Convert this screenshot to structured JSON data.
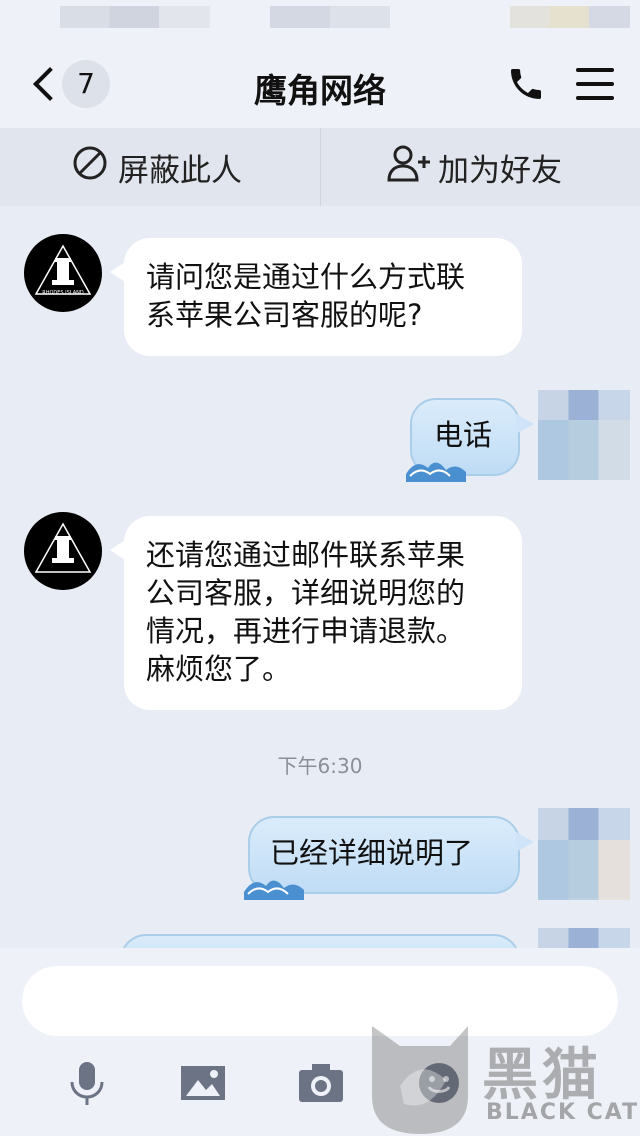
{
  "nav": {
    "unread_count": "7",
    "title": "鹰角网络"
  },
  "actions": {
    "block_label": "屏蔽此人",
    "add_friend_label": "加为好友"
  },
  "messages": [
    {
      "from": "other",
      "text": "请问您是通过什么方式联系苹果公司客服的呢?"
    },
    {
      "from": "me",
      "text": "电话"
    },
    {
      "from": "other",
      "text": "还请您通过邮件联系苹果公司客服，详细说明您的情况，再进行申请退款。麻烦您了。"
    },
    {
      "from": "me",
      "text": "已经详细说明了"
    }
  ],
  "msg_lines": {
    "m1_l1": "请问您是通过什么方式联",
    "m1_l2": "系苹果公司客服的呢?",
    "m3_l1": "还请您通过邮件联系苹果",
    "m3_l2": "公司客服，详细说明您的",
    "m3_l3": "情况，再进行申请退款。",
    "m3_l4": "麻烦您了。"
  },
  "timestamp": "下午6:30",
  "avatar_label": "RHODES ISLAND",
  "watermark": {
    "main": "黑猫",
    "sub": "BLACK CAT"
  },
  "icons": [
    "back-chevron-icon",
    "phone-icon",
    "menu-icon",
    "block-icon",
    "add-friend-icon",
    "microphone-icon",
    "image-icon",
    "camera-icon",
    "emoji-icon"
  ],
  "colors": {
    "outgoing_bubble": "#bfdcf5",
    "incoming_bubble": "#ffffff",
    "background": "#e8ecf5"
  }
}
